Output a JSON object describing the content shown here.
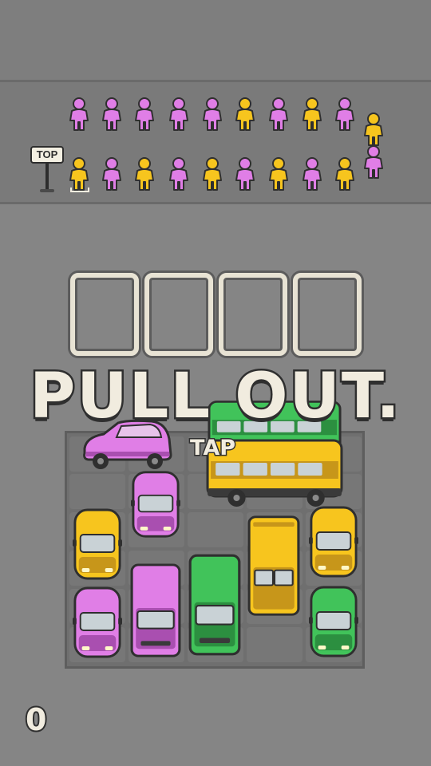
{
  "colors": {
    "pink": "#e07ee6",
    "yellow": "#f7c51e",
    "green": "#41c35a",
    "cream": "#f1ecdf",
    "outline": "#2f2f2f"
  },
  "queue": {
    "sign_label": "TOP",
    "row_front": [
      "yellow",
      "pink",
      "yellow",
      "pink",
      "yellow",
      "pink",
      "yellow",
      "pink",
      "yellow"
    ],
    "row_back": [
      "pink",
      "pink",
      "pink",
      "pink",
      "pink",
      "yellow",
      "pink",
      "yellow",
      "pink"
    ],
    "turn_column": [
      "yellow",
      "pink"
    ]
  },
  "slots": {
    "count": 4,
    "filled": 0
  },
  "banner_text": "PULL OUT.",
  "hint_text": "TAP",
  "score": "0",
  "parking_lot": {
    "vehicles": [
      {
        "kind": "car",
        "color": "pink",
        "orientation": "horizontal",
        "state": "pulling-out"
      },
      {
        "kind": "bus",
        "color": "green",
        "orientation": "horizontal"
      },
      {
        "kind": "bus",
        "color": "yellow",
        "orientation": "horizontal"
      },
      {
        "kind": "car",
        "color": "pink",
        "orientation": "vertical"
      },
      {
        "kind": "car",
        "color": "yellow",
        "orientation": "vertical"
      },
      {
        "kind": "bus",
        "color": "yellow",
        "orientation": "vertical"
      },
      {
        "kind": "car",
        "color": "yellow",
        "orientation": "vertical"
      },
      {
        "kind": "car",
        "color": "pink",
        "orientation": "vertical"
      },
      {
        "kind": "van",
        "color": "pink",
        "orientation": "vertical"
      },
      {
        "kind": "van",
        "color": "green",
        "orientation": "vertical"
      },
      {
        "kind": "car",
        "color": "green",
        "orientation": "vertical"
      }
    ]
  }
}
